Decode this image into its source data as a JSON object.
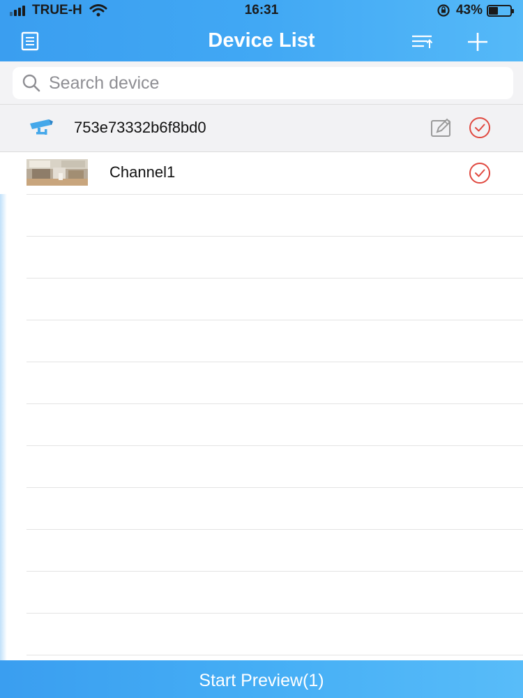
{
  "status_bar": {
    "carrier": "TRUE-H",
    "time": "16:31",
    "battery": "43%",
    "battery_level": 0.43
  },
  "header": {
    "title": "Device List",
    "menu_icon": "list-menu-icon",
    "sort_icon": "sort-icon",
    "add_icon": "plus-icon"
  },
  "search": {
    "placeholder": "Search device"
  },
  "device": {
    "name": "753e73332b6f8bd0",
    "icon": "camera-icon",
    "selected": true,
    "channels": [
      {
        "name": "Channel1",
        "selected": true
      }
    ]
  },
  "footer": {
    "button_label": "Start Preview(1)"
  },
  "colors": {
    "accent": "#41a8f4",
    "check": "#e0483f"
  }
}
